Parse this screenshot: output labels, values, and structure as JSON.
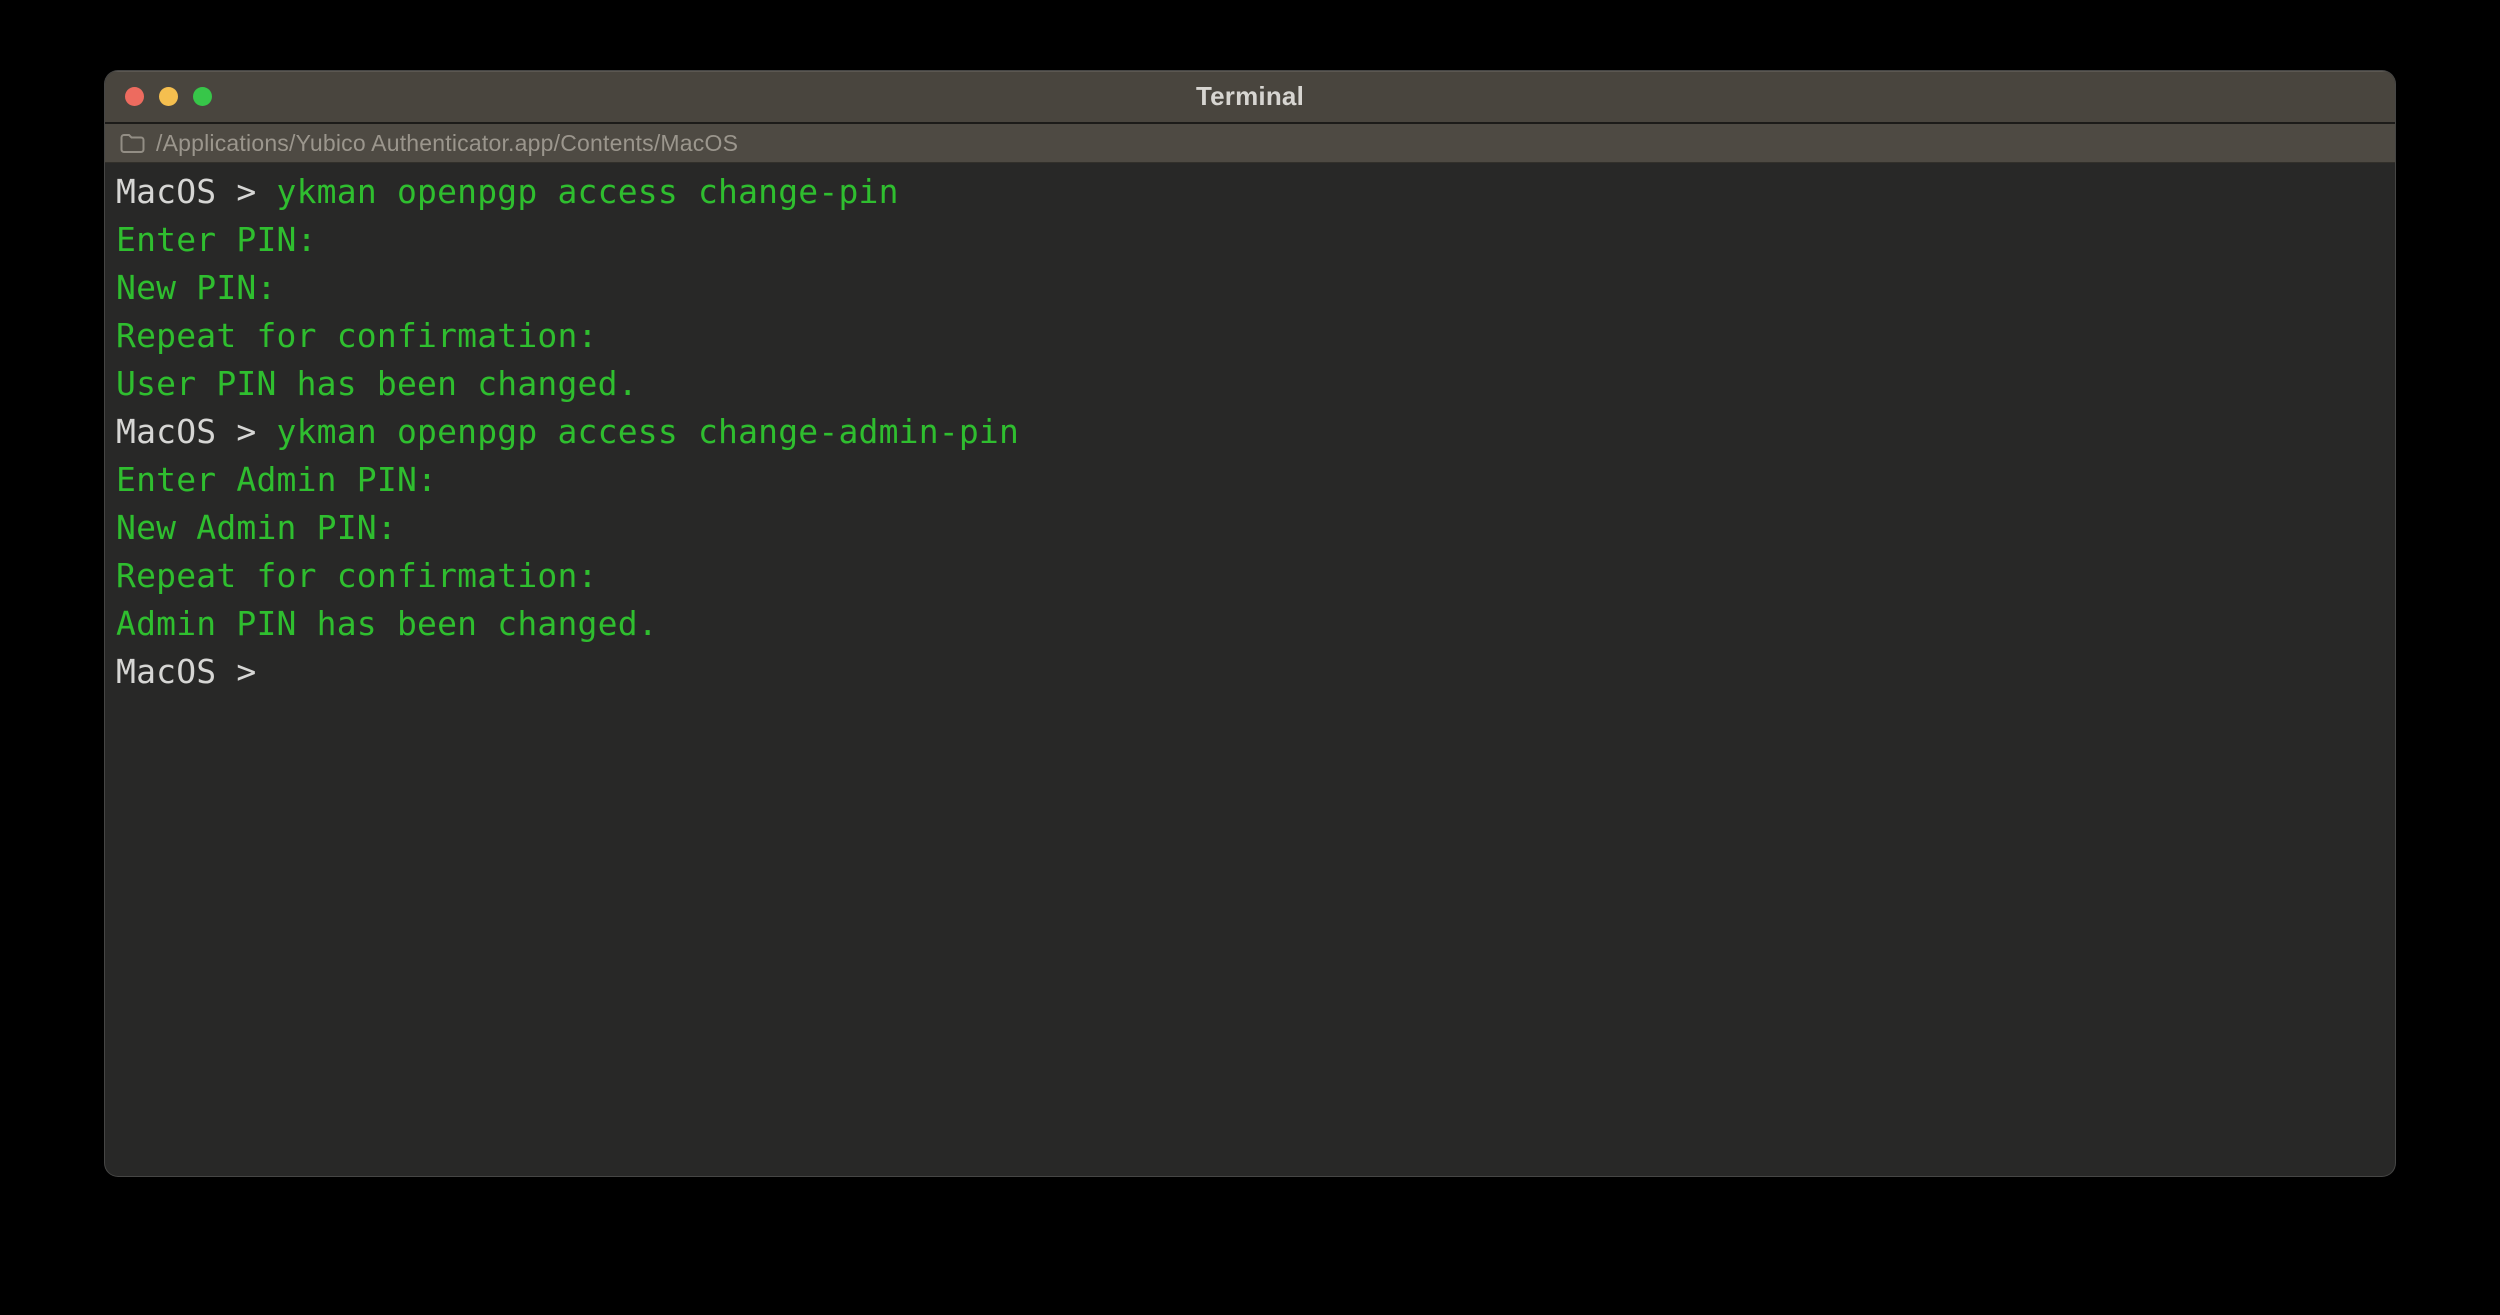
{
  "window": {
    "title": "Terminal",
    "path": "/Applications/Yubico Authenticator.app/Contents/MacOS",
    "traffic_lights": [
      {
        "name": "close-button",
        "color": "#ed6b5f"
      },
      {
        "name": "minimize-button",
        "color": "#f5bf4f"
      },
      {
        "name": "zoom-button",
        "color": "#37c649"
      }
    ]
  },
  "terminal": {
    "prompt": "MacOS > ",
    "lines": [
      {
        "segments": [
          {
            "type": "prompt",
            "text": "MacOS > "
          },
          {
            "type": "command",
            "text": "ykman openpgp access change-pin"
          }
        ]
      },
      {
        "segments": [
          {
            "type": "output",
            "text": "Enter PIN:"
          }
        ]
      },
      {
        "segments": [
          {
            "type": "output",
            "text": "New PIN:"
          }
        ]
      },
      {
        "segments": [
          {
            "type": "output",
            "text": "Repeat for confirmation:"
          }
        ]
      },
      {
        "segments": [
          {
            "type": "output",
            "text": "User PIN has been changed."
          }
        ]
      },
      {
        "segments": [
          {
            "type": "prompt",
            "text": "MacOS > "
          },
          {
            "type": "command",
            "text": "ykman openpgp access change-admin-pin"
          }
        ]
      },
      {
        "segments": [
          {
            "type": "output",
            "text": "Enter Admin PIN:"
          }
        ]
      },
      {
        "segments": [
          {
            "type": "output",
            "text": "New Admin PIN:"
          }
        ]
      },
      {
        "segments": [
          {
            "type": "output",
            "text": "Repeat for confirmation:"
          }
        ]
      },
      {
        "segments": [
          {
            "type": "output",
            "text": "Admin PIN has been changed."
          }
        ]
      },
      {
        "segments": [
          {
            "type": "prompt",
            "text": "MacOS > "
          }
        ]
      }
    ]
  },
  "colors": {
    "terminal_green": "#2fbe2f",
    "prompt_gray": "#d6d6d4",
    "terminal_background": "#282827",
    "titlebar_background": "#49453e",
    "pathbar_background": "#4e4a43",
    "path_text": "#9b968d",
    "desktop_background": "#000000"
  }
}
